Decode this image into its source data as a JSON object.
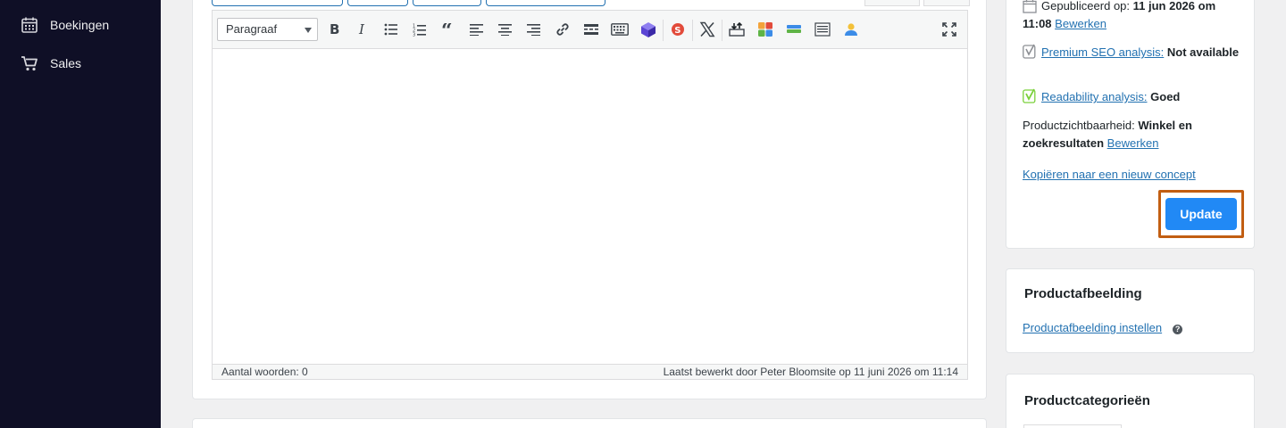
{
  "sidebar": {
    "items": [
      {
        "label": "Boekingen",
        "icon": "calendar-icon"
      },
      {
        "label": "Sales",
        "icon": "cart-icon"
      }
    ]
  },
  "editor": {
    "format_select": "Paragraaf",
    "status_left": "Aantal woorden: 0",
    "status_right": "Laatst bewerkt door Peter Bloomsite op 11 juni 2026 om 11:14"
  },
  "publish": {
    "published_label": "Gepubliceerd op:",
    "published_value": "11 jun 2026 om 11:08",
    "edit_link": "Bewerken",
    "seo_link": "Premium SEO analysis:",
    "seo_value": "Not available",
    "readability_link": "Readability analysis:",
    "readability_value": "Goed",
    "visibility_label": "Productzichtbaarheid:",
    "visibility_value": "Winkel en zoekresultaten",
    "visibility_edit": "Bewerken",
    "copy_link": "Kopiëren naar een nieuw concept",
    "update_button": "Update"
  },
  "product_image": {
    "title": "Productafbeelding",
    "link": "Productafbeelding instellen",
    "help": "?"
  },
  "categories": {
    "title": "Productcategorieën"
  },
  "colors": {
    "sidebar_bg": "#0f0f26",
    "update_button": "#2189f5",
    "highlight_border": "#c25e12",
    "link": "#2271b1"
  }
}
